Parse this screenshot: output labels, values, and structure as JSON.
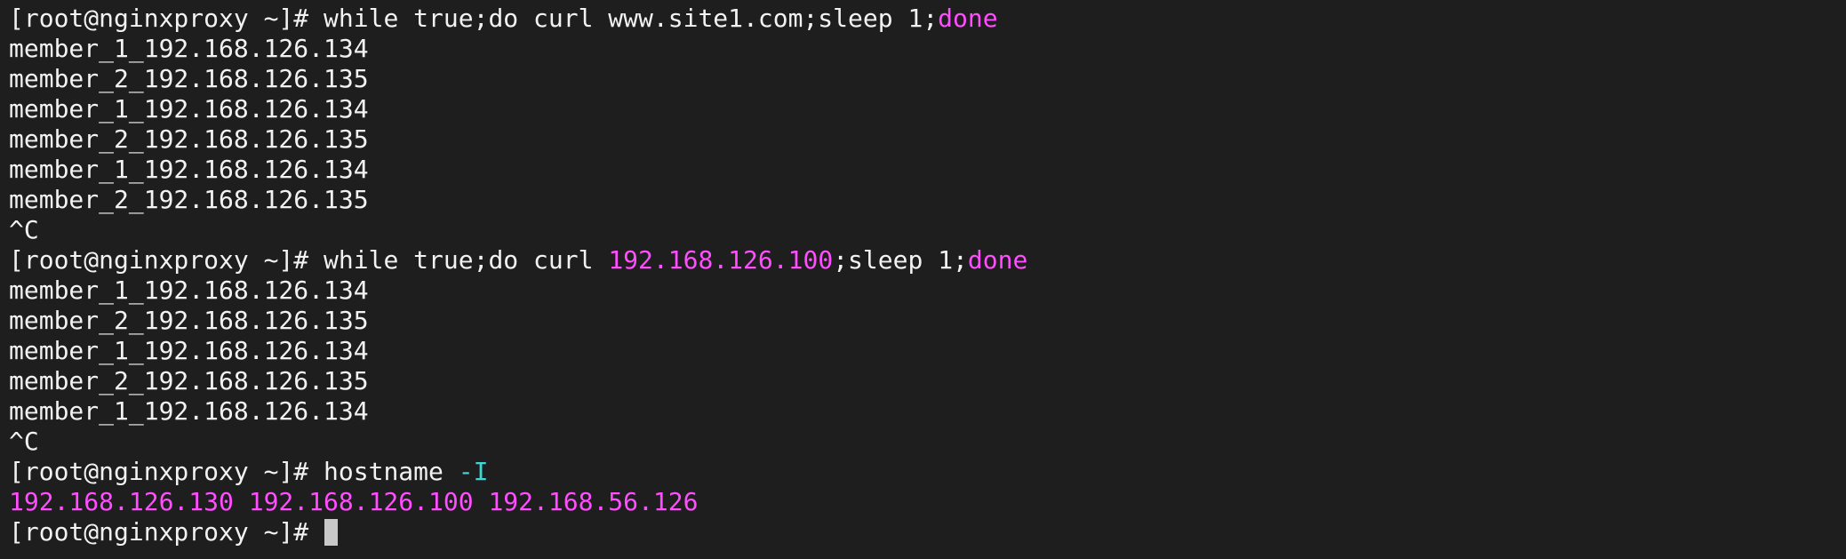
{
  "terminal": {
    "background": "#1e1e1e",
    "colors": {
      "default": "#f2f2f2",
      "keyword": "#ff4dff",
      "ip": "#ff4dff",
      "option": "#3fd6d6",
      "cursor": "#c8c8c8"
    },
    "lines": [
      {
        "kind": "prompt",
        "segments": [
          {
            "text": "[root@nginxproxy ~]# ",
            "color": "default"
          },
          {
            "text": "while true;do curl www.site1.com;sleep 1;",
            "color": "default"
          },
          {
            "text": "done",
            "color": "keyword"
          }
        ]
      },
      {
        "kind": "output",
        "segments": [
          {
            "text": "member_1_192.168.126.134",
            "color": "default"
          }
        ]
      },
      {
        "kind": "output",
        "segments": [
          {
            "text": "member_2_192.168.126.135",
            "color": "default"
          }
        ]
      },
      {
        "kind": "output",
        "segments": [
          {
            "text": "member_1_192.168.126.134",
            "color": "default"
          }
        ]
      },
      {
        "kind": "output",
        "segments": [
          {
            "text": "member_2_192.168.126.135",
            "color": "default"
          }
        ]
      },
      {
        "kind": "output",
        "segments": [
          {
            "text": "member_1_192.168.126.134",
            "color": "default"
          }
        ]
      },
      {
        "kind": "output",
        "segments": [
          {
            "text": "member_2_192.168.126.135",
            "color": "default"
          }
        ]
      },
      {
        "kind": "output",
        "segments": [
          {
            "text": "^C",
            "color": "default"
          }
        ]
      },
      {
        "kind": "prompt",
        "segments": [
          {
            "text": "[root@nginxproxy ~]# ",
            "color": "default"
          },
          {
            "text": "while true;do curl ",
            "color": "default"
          },
          {
            "text": "192.168.126.100",
            "color": "ip"
          },
          {
            "text": ";sleep 1;",
            "color": "default"
          },
          {
            "text": "done",
            "color": "keyword"
          }
        ]
      },
      {
        "kind": "output",
        "segments": [
          {
            "text": "member_1_192.168.126.134",
            "color": "default"
          }
        ]
      },
      {
        "kind": "output",
        "segments": [
          {
            "text": "member_2_192.168.126.135",
            "color": "default"
          }
        ]
      },
      {
        "kind": "output",
        "segments": [
          {
            "text": "member_1_192.168.126.134",
            "color": "default"
          }
        ]
      },
      {
        "kind": "output",
        "segments": [
          {
            "text": "member_2_192.168.126.135",
            "color": "default"
          }
        ]
      },
      {
        "kind": "output",
        "segments": [
          {
            "text": "member_1_192.168.126.134",
            "color": "default"
          }
        ]
      },
      {
        "kind": "output",
        "segments": [
          {
            "text": "^C",
            "color": "default"
          }
        ]
      },
      {
        "kind": "prompt",
        "segments": [
          {
            "text": "[root@nginxproxy ~]# ",
            "color": "default"
          },
          {
            "text": "hostname ",
            "color": "default"
          },
          {
            "text": "-I",
            "color": "option"
          }
        ]
      },
      {
        "kind": "output",
        "segments": [
          {
            "text": "192.168.126.130 192.168.126.100 192.168.56.126",
            "color": "ip"
          }
        ]
      },
      {
        "kind": "prompt",
        "cursor": true,
        "segments": [
          {
            "text": "[root@nginxproxy ~]# ",
            "color": "default"
          }
        ]
      }
    ]
  }
}
